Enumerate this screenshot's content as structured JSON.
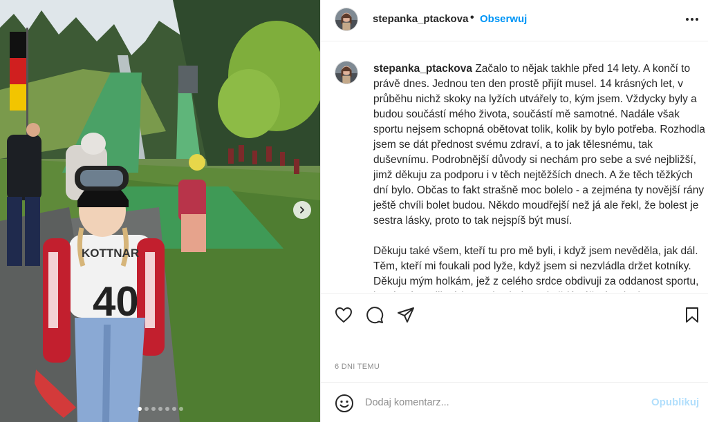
{
  "post": {
    "author": "stepanka_ptackova",
    "follow_label": "Obserwuj",
    "separator": "•",
    "more_icon": "more-options-icon",
    "caption_paragraphs": [
      "Začalo to nějak takhle před 14 lety. A končí to právě dnes. Jednou ten den prostě přijít musel. 14 krásných let, v průběhu nichž skoky na lyžích utvářely to, kým jsem. Vždycky byly a budou součástí mého života, součástí mě samotné. Nadále však sportu nejsem schopná obětovat tolik, kolik by bylo potřeba. Rozhodla jsem se dát přednost svému zdraví, a to jak tělesnému, tak duševnímu. Podrobnější důvody si nechám pro sebe a své nejbližší, jimž děkuju za podporu i v těch nejtěžších dnech. A že těch těžkých dní bylo. Občas to fakt strašně moc bolelo - a zejména ty novější rány ještě chvíli bolet budou. Někdo moudřejší než já ale řekl, že bolest je sestra lásky, proto to tak nejspíš být musí.",
      "Děkuju také všem, kteří tu pro mě byli, i když jsem nevěděla, jak dál. Těm, kteří mi foukali pod lyže, když jsem si nezvládla držet kotníky. Děkuju mým holkám, jež z celého srdce obdivuji za oddanost sportu, který mám tolik ráda. Budu sledovat každý váš závod a i"
    ],
    "timestamp": "6 DNI TEMU",
    "actions": [
      "heart-icon",
      "comment-icon",
      "share-icon",
      "bookmark-icon"
    ]
  },
  "comment_box": {
    "placeholder": "Dodaj komentarz...",
    "post_label": "Opublikuj",
    "emoji_icon": "emoji-icon"
  },
  "photo": {
    "bib_number": "40",
    "bib_text": "KOTTNAR",
    "carousel": {
      "total": 7,
      "current": 1
    },
    "next_icon": "chevron-right-icon"
  },
  "colors": {
    "accent": "#0095f6",
    "post_disabled": "#b2dffc",
    "text": "#262626",
    "muted": "#8e8e8e",
    "divider": "#efefef"
  }
}
